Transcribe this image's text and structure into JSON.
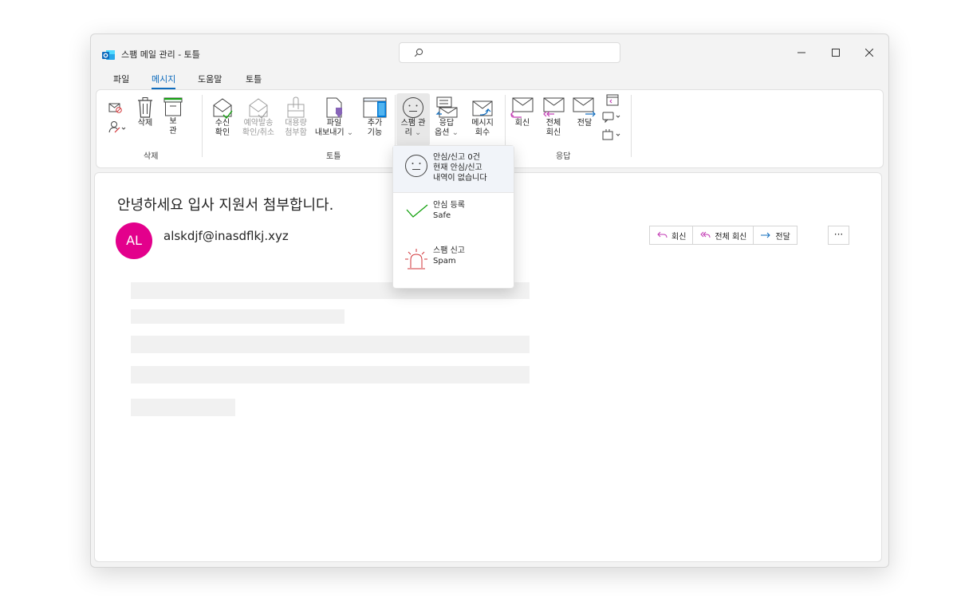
{
  "window": {
    "title": "스팸 메일 관리 - 토틀",
    "search_icon": "search-icon",
    "controls": [
      "minimize-icon",
      "maximize-icon",
      "close-icon"
    ]
  },
  "menubar": {
    "tabs": [
      {
        "label": "파일",
        "active": false
      },
      {
        "label": "메시지",
        "active": true
      },
      {
        "label": "도움말",
        "active": false
      },
      {
        "label": "토틀",
        "active": false
      }
    ]
  },
  "ribbon": {
    "groups": {
      "delete": "삭제",
      "totle": "토틀",
      "respond": "응답"
    },
    "delete_label": "삭제",
    "archive_label_1": "보",
    "archive_label_2": "관",
    "receipt_label_1": "수신",
    "receipt_label_2": "확인",
    "schedule_label_1": "예약발송",
    "schedule_label_2": "확인/취소",
    "bulk_label_1": "대용량",
    "bulk_label_2": "첨부함",
    "export_label_1": "파일",
    "export_label_2": "내보내기",
    "addon_label_1": "추가",
    "addon_label_2": "기능",
    "spam_label_1": "스팸 관",
    "spam_label_2": "리",
    "response_opt_1": "응답",
    "response_opt_2": "옵션",
    "recall_1": "메시지",
    "recall_2": "회수",
    "reply_label": "회신",
    "reply_all_1": "전체",
    "reply_all_2": "회신",
    "forward_label": "전달"
  },
  "message": {
    "subject": "안녕하세요 입사 지원서 첨부합니다.",
    "avatar_initials": "AL",
    "sender": "alskdjf@inasdflkj.xyz",
    "actions": {
      "reply": "회신",
      "reply_all": "전체 회신",
      "forward": "전달",
      "more": "···"
    }
  },
  "spam_menu": {
    "status_line1": "안심/신고 0건",
    "status_line2": "현재 안심/신고",
    "status_line3": "내역이 없습니다",
    "safe_title": "안심 등록",
    "safe_sub": "Safe",
    "spam_title": "스팸 신고",
    "spam_sub": "Spam"
  },
  "colors": {
    "accent": "#0f6cbd",
    "avatar": "#e3008c",
    "safe": "#13a10e",
    "spam": "#d13438",
    "reply_icon": "#c239b3"
  }
}
